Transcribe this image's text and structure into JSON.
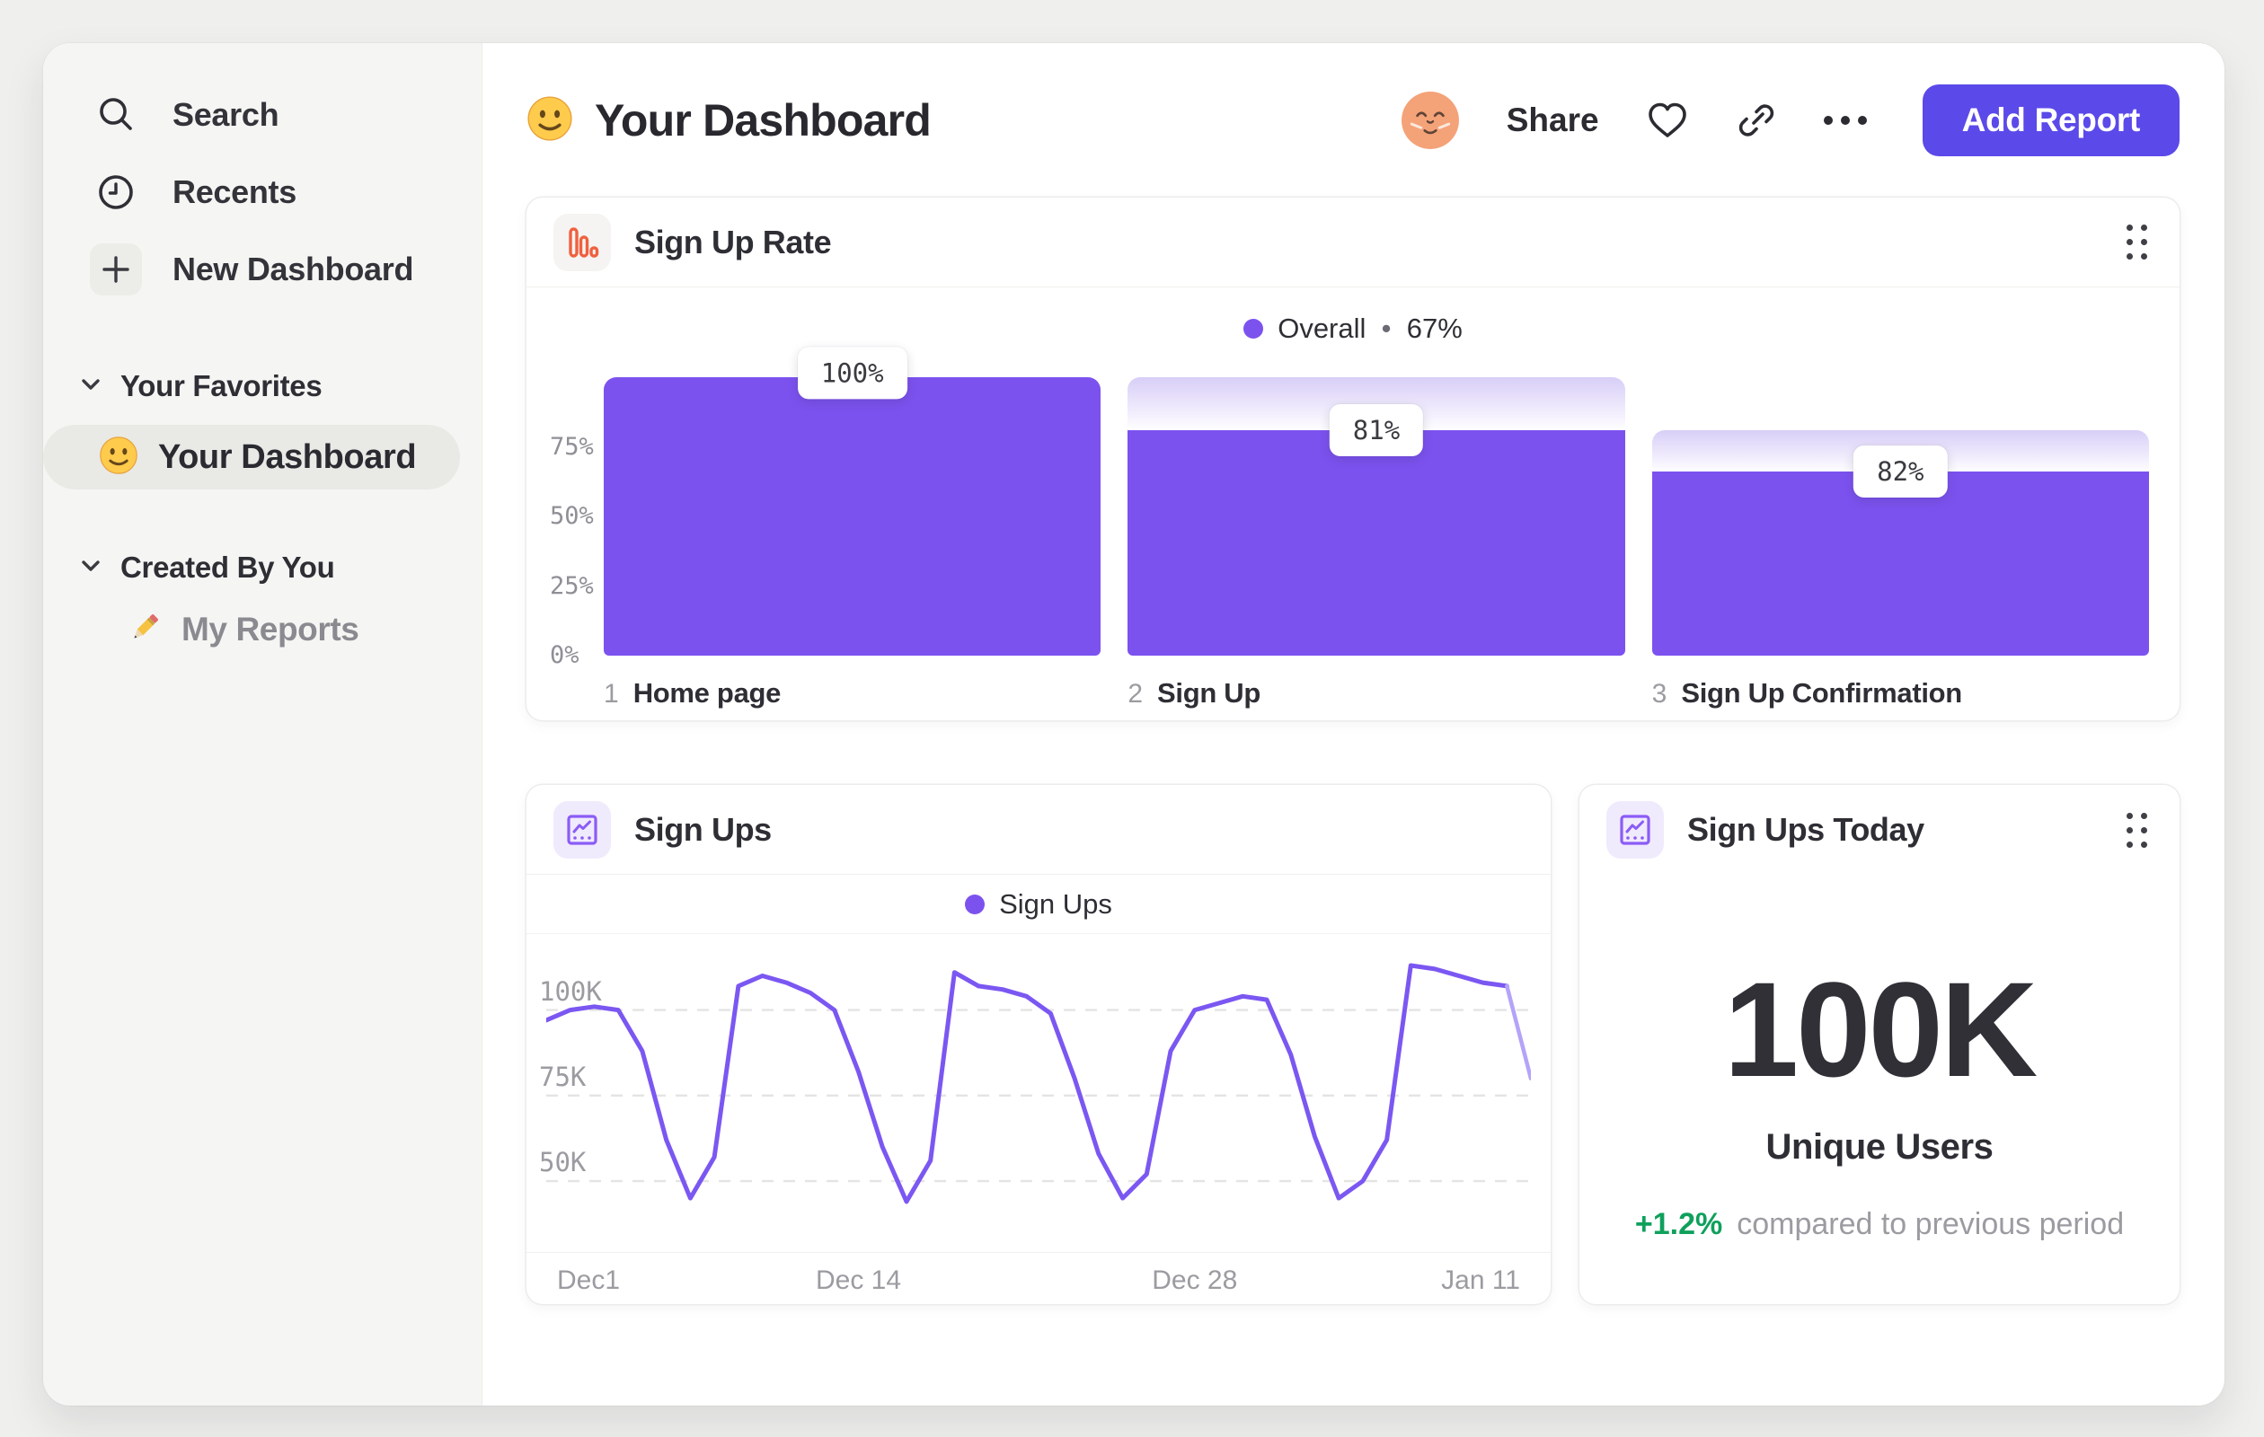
{
  "sidebar": {
    "nav": [
      {
        "label": "Search",
        "icon": "search-icon"
      },
      {
        "label": "Recents",
        "icon": "clock-icon"
      },
      {
        "label": "New Dashboard",
        "icon": "plus-icon"
      }
    ],
    "sections": [
      {
        "title": "Your Favorites"
      },
      {
        "title": "Created By You"
      }
    ],
    "favorite_item": {
      "label": "Your Dashboard",
      "emoji": "smiley",
      "selected": true
    },
    "report_item": {
      "label": "My Reports",
      "emoji": "pencil"
    }
  },
  "header": {
    "title": "Your Dashboard",
    "share_label": "Share",
    "add_report_label": "Add Report"
  },
  "cards": {
    "funnel": {
      "title": "Sign Up Rate",
      "legend_series": "Overall",
      "legend_sep": "•",
      "legend_value": "67%"
    },
    "line": {
      "title": "Sign Ups",
      "legend_series": "Sign Ups"
    },
    "today": {
      "title": "Sign Ups Today",
      "metric": "100K",
      "metric_label": "Unique Users",
      "change": "+1.2%",
      "change_note": "compared to previous period"
    }
  },
  "colors": {
    "bar_purple": "#7C52EF",
    "line_purple": "#7B57F2",
    "line_light_tail": "#B5A3F8",
    "button_indigo": "#5B49E9",
    "funnel_icon_orange": "#F0603F",
    "line_icon_purple": "#8B5CF6",
    "positive_green": "#0FA05C",
    "grid_gray": "#E4E4E2"
  },
  "chart_data": [
    {
      "type": "bar",
      "title": "Sign Up Rate",
      "series_name": "Overall",
      "overall_rate": "67%",
      "categories": [
        "Home page",
        "Sign Up",
        "Sign Up Confirmation"
      ],
      "step_numbers": [
        "1",
        "2",
        "3"
      ],
      "values": [
        100,
        81,
        82
      ],
      "value_labels": [
        "100%",
        "81%",
        "82%"
      ],
      "fill_pct": [
        100,
        81,
        66
      ],
      "cap_pct": [
        100,
        100,
        81
      ],
      "y_ticks": [
        75,
        50,
        25,
        0
      ],
      "y_tick_labels": [
        "75%",
        "50%",
        "25%",
        "0%"
      ],
      "ylim": [
        0,
        100
      ]
    },
    {
      "type": "line",
      "title": "Sign Ups",
      "series": [
        {
          "name": "Sign Ups",
          "values": [
            97,
            100,
            101,
            100,
            88,
            62,
            45,
            57,
            107,
            110,
            108,
            105,
            100,
            82,
            60,
            44,
            56,
            111,
            107,
            106,
            104,
            99,
            80,
            58,
            45,
            52,
            88,
            100,
            102,
            104,
            103,
            87,
            63,
            45,
            50,
            62,
            113,
            112,
            110,
            108,
            107,
            80
          ]
        }
      ],
      "values_unit": "K",
      "x_tick_labels": [
        "Dec1",
        "Dec 14",
        "Dec 28",
        "Jan 11"
      ],
      "x_tick_positions": [
        0,
        13,
        27,
        41
      ],
      "y_ticks": [
        100,
        75,
        50
      ],
      "y_tick_labels": [
        "100K",
        "75K",
        "50K"
      ],
      "ylim": [
        34,
        118
      ],
      "light_tail_segments": 1,
      "grid": "dashed"
    }
  ]
}
